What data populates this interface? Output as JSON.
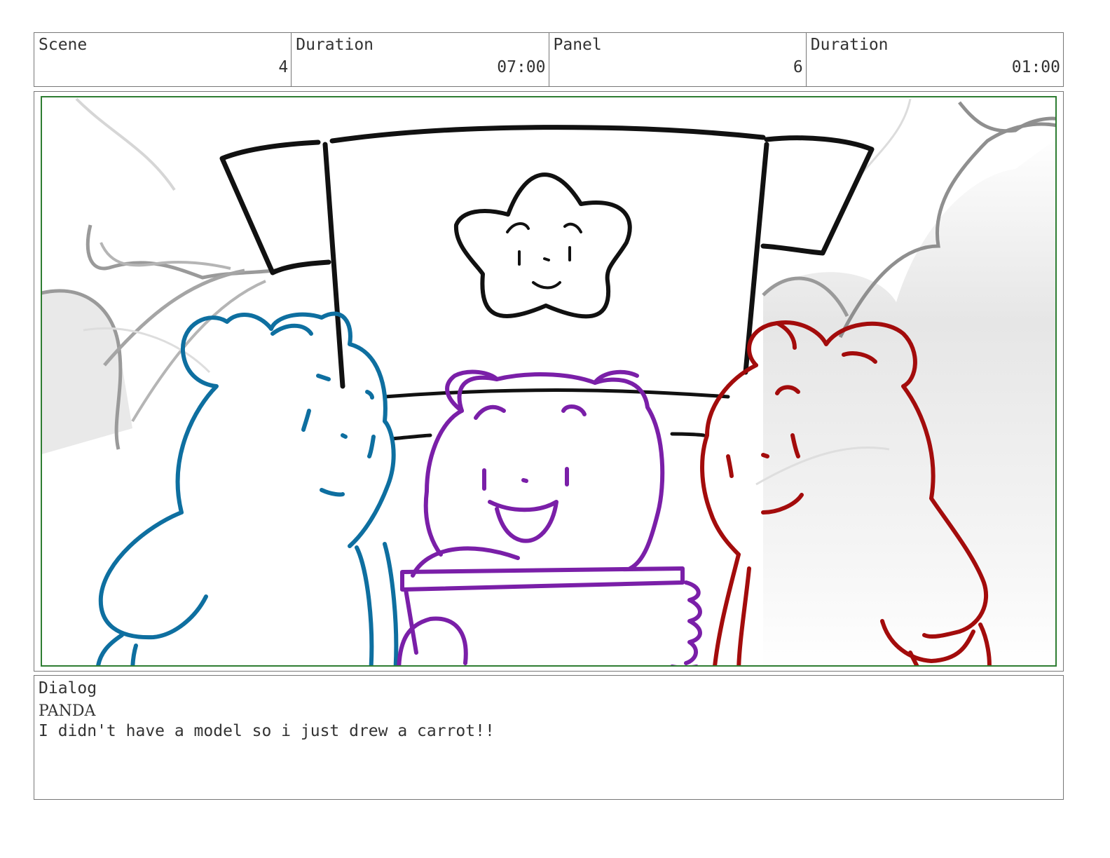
{
  "header": {
    "scene_label": "Scene",
    "scene_value": "4",
    "scene_duration_label": "Duration",
    "scene_duration_value": "07:00",
    "panel_label": "Panel",
    "panel_value": "6",
    "panel_duration_label": "Duration",
    "panel_duration_value": "01:00"
  },
  "colors": {
    "frame_border": "#2e7d32",
    "blue_bear": "#0e6fa0",
    "purple_bear": "#7a1fa8",
    "red_bear": "#a30c0c",
    "ink": "#111111"
  },
  "dialog": {
    "label": "Dialog",
    "speaker": "PANDA",
    "line": "I didn't have a model so i just drew a carrot!!"
  }
}
